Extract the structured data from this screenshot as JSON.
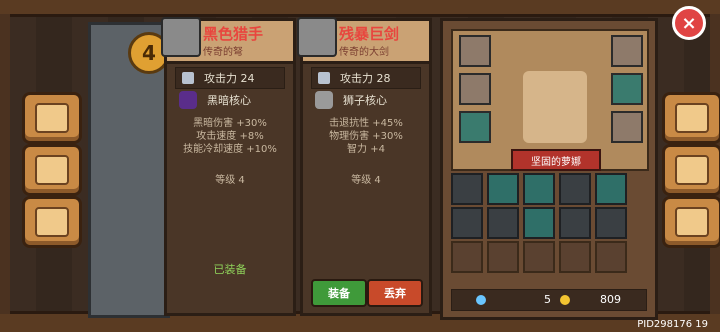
{
  "level": "4",
  "weapon_equipped": {
    "title": "黑色猎手",
    "subtitle": "传奇的弩",
    "stat_label": "攻击力 24",
    "core_label": "黑暗核心",
    "attrs": [
      "黑暗伤害 +30%",
      "攻击速度 +8%",
      "技能冷却速度 +10%"
    ],
    "level_text": "等级 4",
    "status_text": "已装备"
  },
  "weapon_other": {
    "title": "残暴巨剑",
    "subtitle": "传奇的大剑",
    "stat_label": "攻击力 28",
    "core_label": "狮子核心",
    "attrs": [
      "击退抗性 +45%",
      "物理伤害 +30%",
      "智力 +4"
    ],
    "level_text": "等级 4",
    "equip_button": "装备",
    "discard_button": "丢弃"
  },
  "hero_name": "坚固的萝娜",
  "currency": {
    "gems": "5",
    "gold": "809"
  },
  "pid": "PID298176 19",
  "close_icon": "×",
  "colors": {
    "equip": "#3f9a3a",
    "discard": "#c84a2a"
  }
}
